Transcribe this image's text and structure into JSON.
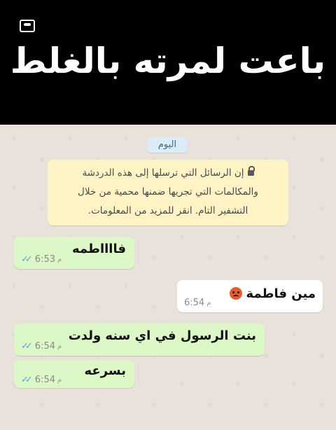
{
  "banner": {
    "title": "باعت لمرته بالغلط",
    "logo_icon": "tv-channel-logo-icon"
  },
  "chat": {
    "date_chip": "اليوم",
    "encryption_notice": "إن الرسائل التي ترسلها إلى هذه الدردشة والمكالمات التي تجريها ضمنها محمية من خلال التشفير التام. انقر للمزيد من المعلومات.",
    "messages": [
      {
        "direction": "out",
        "text": "فااااطمه",
        "time": "6:53",
        "ampm": "م",
        "status": "read"
      },
      {
        "direction": "in",
        "text": "مين فاطمة",
        "emoji": "angry-face-emoji",
        "time": "6:54",
        "ampm": "م"
      },
      {
        "direction": "out",
        "text": "بنت الرسول في اي سنه ولدت",
        "time": "6:54",
        "ampm": "م",
        "status": "read"
      },
      {
        "direction": "out",
        "text": "بسرعه",
        "time": "6:54",
        "ampm": "م",
        "status": "read"
      }
    ]
  },
  "colors": {
    "outgoing_bubble": "#dcf8c6",
    "incoming_bubble": "#ffffff",
    "chat_background": "#e9e2da",
    "notice_background": "#fdf3c4",
    "read_ticks": "#4fa7d8"
  },
  "icons": {
    "lock": "lock-icon",
    "read_receipt": "double-check-icon"
  }
}
